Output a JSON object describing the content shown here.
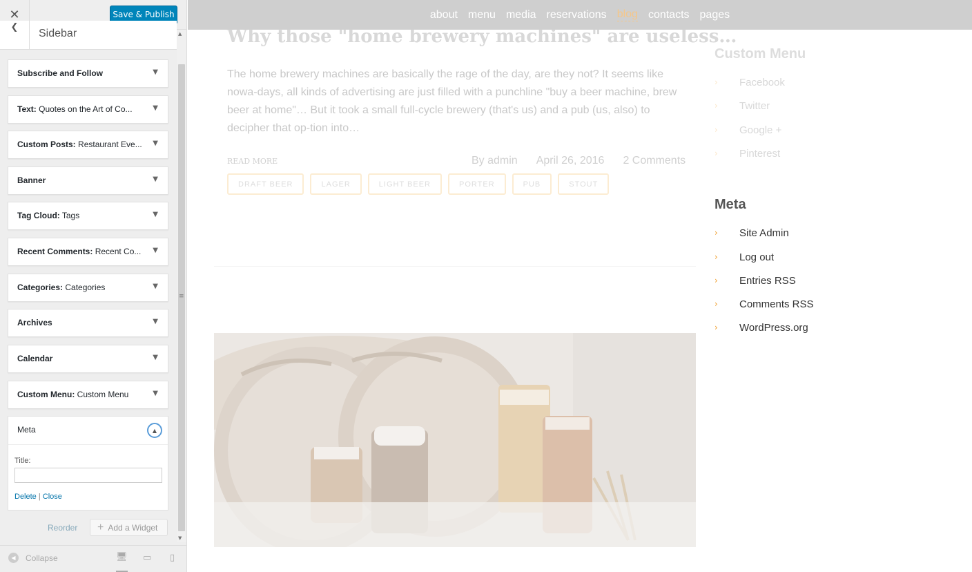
{
  "customizer": {
    "close_glyph": "✕",
    "save_label": "Save & Publish",
    "back_glyph": "❮",
    "section_title": "Sidebar",
    "widgets": [
      {
        "name": "Subscribe and Follow",
        "sub": ""
      },
      {
        "name": "Text:",
        "sub": " Quotes on the Art of Co..."
      },
      {
        "name": "Custom Posts:",
        "sub": " Restaurant Eve..."
      },
      {
        "name": "Banner",
        "sub": ""
      },
      {
        "name": "Tag Cloud:",
        "sub": " Tags"
      },
      {
        "name": "Recent Comments:",
        "sub": " Recent Co..."
      },
      {
        "name": "Categories:",
        "sub": " Categories"
      },
      {
        "name": "Archives",
        "sub": ""
      },
      {
        "name": "Calendar",
        "sub": ""
      },
      {
        "name": "Custom Menu:",
        "sub": " Custom Menu"
      }
    ],
    "meta_widget": {
      "name": "Meta",
      "title_label": "Title:",
      "title_value": "",
      "delete_label": "Delete",
      "separator": "|",
      "close_label": "Close"
    },
    "reorder_label": "Reorder",
    "add_widget_label": "Add a Widget",
    "collapse_label": "Collapse"
  },
  "preview": {
    "nav": [
      "about",
      "menu",
      "media",
      "reservations",
      "blog",
      "contacts",
      "pages"
    ],
    "nav_active": "blog",
    "post": {
      "title": "Why those \"home brewery machines\" are useless…",
      "excerpt": "The home brewery machines are basically the rage of the day, are they not? It seems like nowa-days, all kinds of advertising are just filled with a punchline \"buy a beer machine, brew beer at home\"… But it took a small full-cycle brewery (that's us) and a pub (us, also) to decipher that op-tion into…",
      "read_more": "READ MORE",
      "author": "By admin",
      "date": "April 26, 2016",
      "comments": "2 Comments",
      "tags": [
        "DRAFT BEER",
        "LAGER",
        "LIGHT BEER",
        "PORTER",
        "PUB",
        "STOUT"
      ]
    },
    "custom_menu": {
      "title": "Custom Menu",
      "items": [
        "Facebook",
        "Twitter",
        "Google +",
        "Pinterest"
      ]
    },
    "meta": {
      "title": "Meta",
      "items": [
        "Site Admin",
        "Log out",
        "Entries RSS",
        "Comments RSS",
        "WordPress.org"
      ]
    }
  },
  "colors": {
    "primary_button": "#0085ba",
    "link": "#0073aa",
    "accent": "#f0a030"
  }
}
